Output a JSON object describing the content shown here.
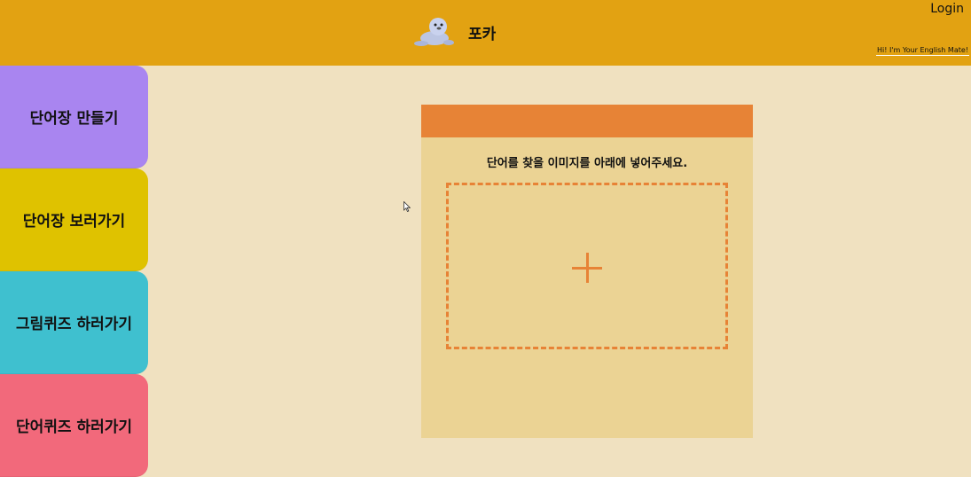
{
  "header": {
    "brand_name": "포카",
    "login_label": "Login",
    "tagline": "Hi! I'm Your English Mate!",
    "logo_icon": "seal-icon",
    "background_color": "#e2a212"
  },
  "sidebar": {
    "items": [
      {
        "label": "단어장 만들기",
        "color": "#a985f0"
      },
      {
        "label": "단어장 보러가기",
        "color": "#dfc200"
      },
      {
        "label": "그림퀴즈 하러가기",
        "color": "#3fc0cf"
      },
      {
        "label": "단어퀴즈 하러가기",
        "color": "#f2697b"
      }
    ]
  },
  "main": {
    "instruction": "단어를 찾을 이미지를 아래에 넣어주세요.",
    "dropzone_icon": "plus-icon",
    "accent_color": "#e78336",
    "card_color": "#ebd394"
  },
  "page": {
    "background_color": "#f0e1c0"
  }
}
